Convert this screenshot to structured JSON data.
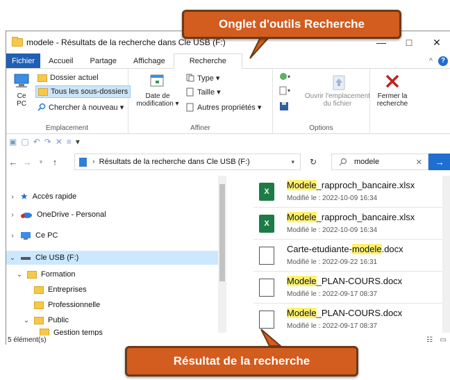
{
  "window": {
    "title": "modele - Résultats de la recherche dans Cle USB (F:)",
    "close_glyph": "✕",
    "minimize_glyph": "—",
    "maximize_glyph": "□"
  },
  "tabs": {
    "file": "Fichier",
    "home": "Accueil",
    "share": "Partage",
    "view": "Affichage",
    "search": "Recherche",
    "collapse_glyph": "^",
    "help_glyph": "?"
  },
  "ribbon": {
    "location": {
      "pc_label_line1": "Ce",
      "pc_label_line2": "PC",
      "current_folder": "Dossier actuel",
      "all_subfolders": "Tous les sous-dossiers",
      "search_again": "Chercher à nouveau ▾",
      "group_label": "Emplacement"
    },
    "refine": {
      "date_modified_line1": "Date de",
      "date_modified_line2": "modification ▾",
      "type": "Type ▾",
      "size": "Taille ▾",
      "other_props": "Autres propriétés ▾",
      "group_label": "Affiner"
    },
    "options": {
      "open_location_line1": "Ouvrir l'emplacement",
      "open_location_line2": "du fichier",
      "group_label": "Options"
    },
    "close": {
      "label_line1": "Fermer la",
      "label_line2": "recherche"
    }
  },
  "address": {
    "path": "Résultats de la recherche dans Cle USB (F:)",
    "search_value": "modele"
  },
  "nav_tree": [
    {
      "label": "Accès rapide"
    },
    {
      "label": "OneDrive - Personal"
    },
    {
      "label": "Ce PC"
    },
    {
      "label": "Cle USB (F:)"
    },
    {
      "label": "Formation"
    },
    {
      "label": "Entreprises"
    },
    {
      "label": "Professionnelle"
    },
    {
      "label": "Public"
    },
    {
      "label": "Gestion temps"
    }
  ],
  "results": [
    {
      "match": "Modele",
      "rest": "_rapproch_bancaire.xlsx",
      "meta": "Modifié le : 2022-10-09 16:34",
      "type": "xlsx"
    },
    {
      "match": "Modele",
      "rest": "_rapproch_bancaire.xlsx",
      "meta": "Modifié le : 2022-10-09 16:34",
      "type": "xlsx"
    },
    {
      "prefix": "Carte-etudiante-",
      "match": "modele",
      "rest": ".docx",
      "meta": "Modifié le : 2022-09-22 16:31",
      "type": "docx"
    },
    {
      "match": "Modele",
      "rest": "_PLAN-COURS.docx",
      "meta": "Modifié le : 2022-09-17 08:37",
      "type": "docx"
    },
    {
      "match": "Modele",
      "rest": "_PLAN-COURS.docx",
      "meta": "Modifié le : 2022-09-17 08:37",
      "type": "docx"
    }
  ],
  "status": {
    "count": "5 élément(s)"
  },
  "callouts": {
    "top": "Onglet d'outils Recherche",
    "bottom": "Résultat de la recherche"
  },
  "colors": {
    "callout_fill": "#d35c1f",
    "callout_border": "#6b3a17",
    "accent": "#1f6fd0",
    "highlight": "#fff170"
  }
}
